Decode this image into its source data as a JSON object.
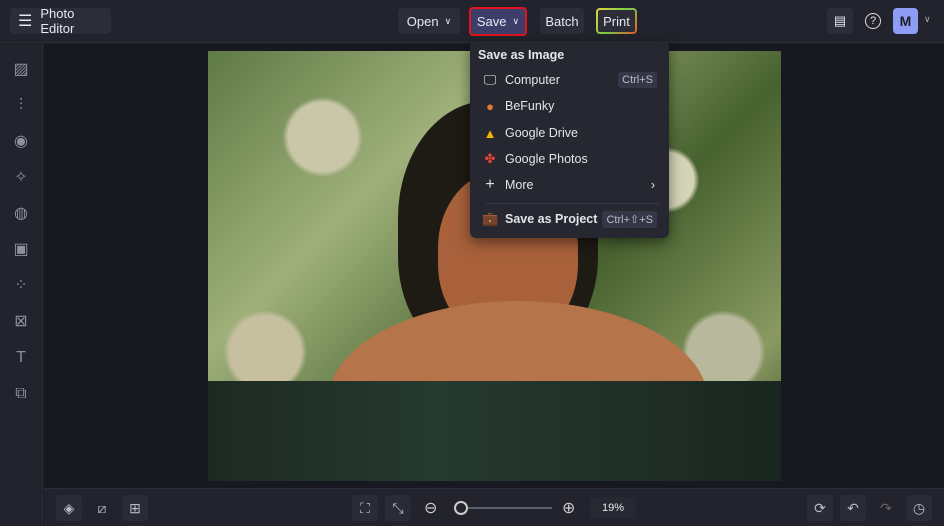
{
  "header": {
    "app_title": "Photo Editor",
    "open": "Open",
    "save": "Save",
    "batch": "Batch",
    "print": "Print",
    "avatar": "M"
  },
  "save_menu": {
    "heading": "Save as Image",
    "items": [
      {
        "label": "Computer",
        "shortcut": "Ctrl+S",
        "icon": "monitor-icon"
      },
      {
        "label": "BeFunky",
        "icon": "befunky-icon"
      },
      {
        "label": "Google Drive",
        "icon": "google-drive-icon"
      },
      {
        "label": "Google Photos",
        "icon": "google-photos-icon"
      },
      {
        "label": "More",
        "icon": "plus-icon"
      }
    ],
    "project": {
      "label": "Save as Project",
      "shortcut": "Ctrl+⇧+S"
    }
  },
  "footer": {
    "zoom_level": "19%",
    "zoom_fraction": 0.04
  },
  "colors": {
    "accent": "#8f9cf5",
    "save_highlight": "#e0141e"
  }
}
